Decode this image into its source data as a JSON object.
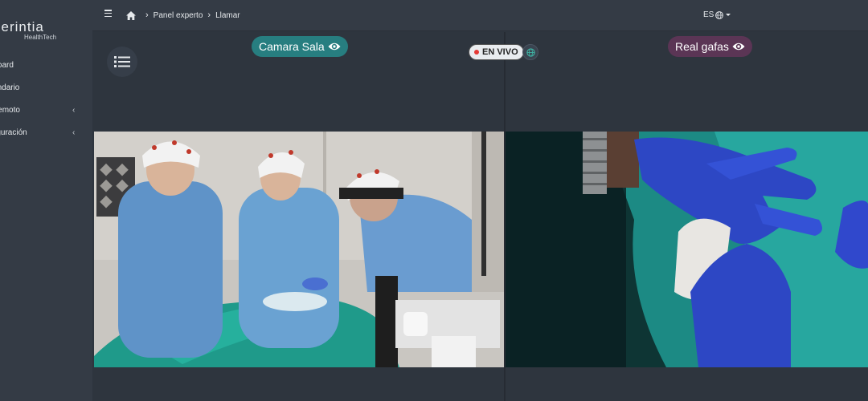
{
  "brand": {
    "name": "zerintia",
    "tagline": "HealthTech"
  },
  "sidebar": {
    "items": [
      {
        "label": "Dashboard",
        "expandable": false
      },
      {
        "label": "Calendario",
        "expandable": false
      },
      {
        "label": "Soporte remoto",
        "expandable": true
      },
      {
        "label": "Configuración",
        "expandable": true
      }
    ]
  },
  "header": {
    "breadcrumb": [
      "Panel experto",
      "Llamar"
    ],
    "language": "ES"
  },
  "call": {
    "left_feed_label": "Camara Sala",
    "right_feed_label": "Real gafas",
    "live_label": "EN VIVO"
  },
  "colors": {
    "sidebar_bg": "#343b45",
    "main_bg": "#2e353e",
    "left_pill": "#277e80",
    "right_pill": "#5b3555",
    "live_dot": "#e53935"
  },
  "icons": [
    "menu-icon",
    "home-icon",
    "chevron-right-icon",
    "globe-icon",
    "list-icon",
    "eye-icon",
    "network-icon"
  ]
}
